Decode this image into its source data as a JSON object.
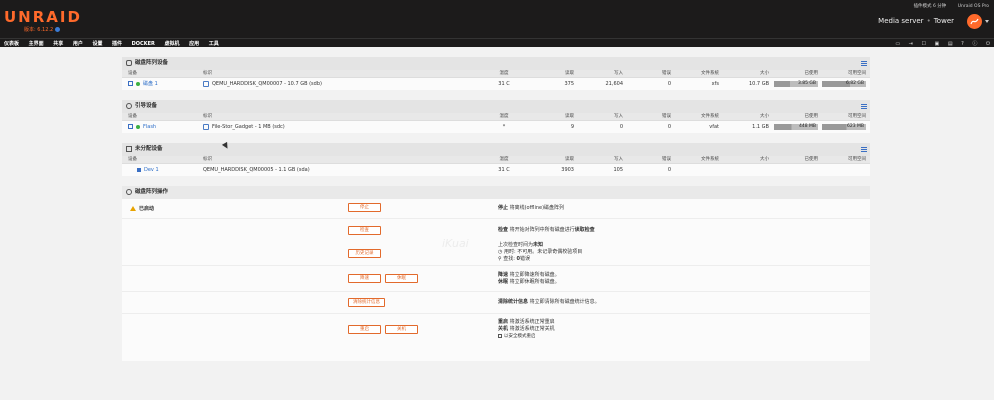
{
  "header": {
    "logo": "UNRAID",
    "version": "版本: 6.12.2",
    "top_links": [
      "插件模式 6 分钟",
      "Unraid OS Pro"
    ],
    "server_name": "Media server",
    "server_sep": "•",
    "server_host": "Tower",
    "accent_color": "#ff6a2b"
  },
  "nav": {
    "items": [
      "仪表板",
      "主界面",
      "共享",
      "用户",
      "设置",
      "插件",
      "DOCKER",
      "虚拟机",
      "应用",
      "工具"
    ],
    "icons": [
      "terminal-icon",
      "log-icon",
      "feedback-icon",
      "monitor-icon",
      "lock-icon",
      "help-icon",
      "info-icon",
      "power-icon"
    ]
  },
  "columns": {
    "device": "设备",
    "id": "标识",
    "temp": "温度",
    "reads": "读取",
    "writes": "写入",
    "errors": "错误",
    "fs": "文件系统",
    "size": "大小",
    "used": "已使用",
    "free": "可用空间"
  },
  "array": {
    "title": "磁盘阵列设备",
    "rows": [
      {
        "device": "磁盘 1",
        "id": "QEMU_HARDDISK_QM00007 - 10.7 GB (sdb)",
        "temp": "31 C",
        "reads": "375",
        "writes": "21,604",
        "errors": "0",
        "fs": "xfs",
        "size": "10.7 GB",
        "used": "3.85 GB",
        "free": "6.82 GB",
        "used_pct": 36,
        "free_pct": 64,
        "status_color": "#3cb043"
      }
    ]
  },
  "boot": {
    "title": "引导设备",
    "rows": [
      {
        "device": "Flash",
        "id": "File-Stor_Gadget - 1 MB (sdc)",
        "temp": "*",
        "reads": "9",
        "writes": "0",
        "errors": "0",
        "fs": "vfat",
        "size": "1.1 GB",
        "used": "448 MB",
        "free": "623 MB",
        "used_pct": 40,
        "free_pct": 56,
        "status_color": "#3cb043"
      }
    ]
  },
  "unassigned": {
    "title": "未分配设备",
    "rows": [
      {
        "device": "Dev 1",
        "id": "QEMU_HARDDISK_QM00005 - 1.1 GB (sda)",
        "temp": "31 C",
        "reads": "3903",
        "writes": "105",
        "errors": "0",
        "status_color": "#3a6fc4"
      }
    ]
  },
  "operations": {
    "title": "磁盘阵列操作",
    "status": "已启动",
    "watermark": "iKuai",
    "buttons": {
      "stop": "停止",
      "check": "检查",
      "history": "历史记录",
      "spin_down": "降速",
      "spin_up": "休眠",
      "clear_stats": "清除统计信息",
      "reboot": "重启",
      "shutdown": "关机"
    },
    "texts": {
      "stop_b": "停止",
      "stop": " 将离线(offline)磁盘阵列",
      "check_b": "检查",
      "check_mid": " 将开始对阵列中所有磁盘进行",
      "check_b2": "读取检查",
      "last_check_a": "上次检查时间为",
      "last_check_b": "未知",
      "last_check_2": "用时: 不可用。未记录奇偶校验项目",
      "last_check_3_a": "查找: ",
      "last_check_3_b": "0",
      "last_check_3_c": "错误",
      "spindown_b": "降速",
      "spindown": " 将立即降速所有磁盘。",
      "spinup_b": "休眠",
      "spinup": " 将立即休眠所有磁盘。",
      "clear_b": "清除统计信息",
      "clear": " 将立即清除所有磁盘统计信息。",
      "reboot_b": "重启",
      "reboot": " 将激活系统正常重启",
      "shutdown_b": "关机",
      "shutdown": " 将激活系统正常关机",
      "safe_mode": "以安全模式重启"
    }
  }
}
